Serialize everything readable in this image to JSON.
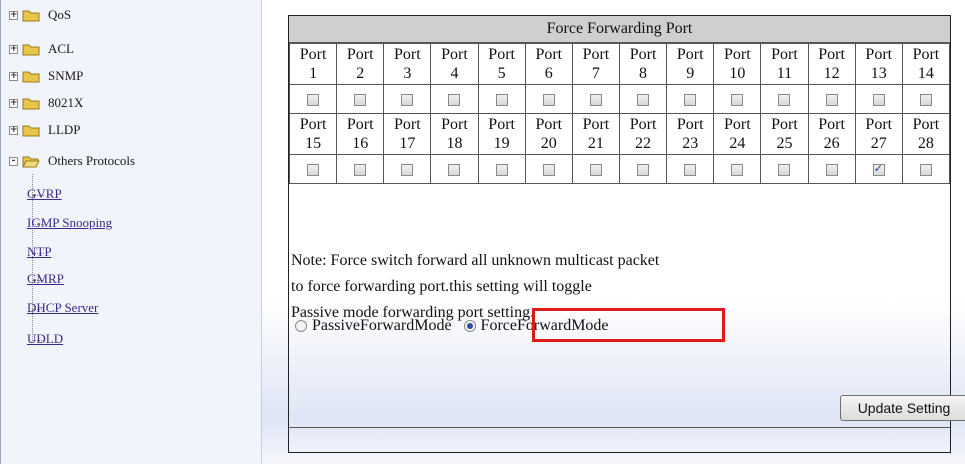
{
  "tree": {
    "nodes": [
      {
        "label": "QoS",
        "expander": "+",
        "icon": "folder-icon"
      },
      {
        "label": "ACL",
        "expander": "+",
        "icon": "folder-icon"
      },
      {
        "label": "SNMP",
        "expander": "+",
        "icon": "folder-icon"
      },
      {
        "label": "8021X",
        "expander": "+",
        "icon": "folder-icon"
      },
      {
        "label": "LLDP",
        "expander": "+",
        "icon": "folder-icon"
      },
      {
        "label": "Others Protocols",
        "expander": "-",
        "icon": "folder-open-icon"
      }
    ],
    "links": [
      "GVRP",
      "IGMP Snooping",
      "NTP",
      "GMRP",
      "DHCP Server",
      "UDLD"
    ]
  },
  "panel": {
    "title": "Force Forwarding Port",
    "port_word": "Port",
    "row1_ports": [
      "1",
      "2",
      "3",
      "4",
      "5",
      "6",
      "7",
      "8",
      "9",
      "10",
      "11",
      "12",
      "13",
      "14"
    ],
    "row1_checked": [
      false,
      false,
      false,
      false,
      false,
      false,
      false,
      false,
      false,
      false,
      false,
      false,
      false,
      false
    ],
    "row2_ports": [
      "15",
      "16",
      "17",
      "18",
      "19",
      "20",
      "21",
      "22",
      "23",
      "24",
      "25",
      "26",
      "27",
      "28"
    ],
    "row2_checked": [
      false,
      false,
      false,
      false,
      false,
      false,
      false,
      false,
      false,
      false,
      false,
      false,
      true,
      false
    ],
    "note_lines": [
      "Note: Force switch forward all unknown multicast packet",
      "to force forwarding port.this setting will toggle",
      "Passive mode forwarding port setting."
    ],
    "mode_passive": "PassiveForwardMode",
    "mode_force": "ForceForwardMode",
    "selected_mode": "ForceForwardMode",
    "update_button": "Update Setting"
  },
  "colors": {
    "highlight": "#e11919",
    "link": "#3c2a8c"
  }
}
